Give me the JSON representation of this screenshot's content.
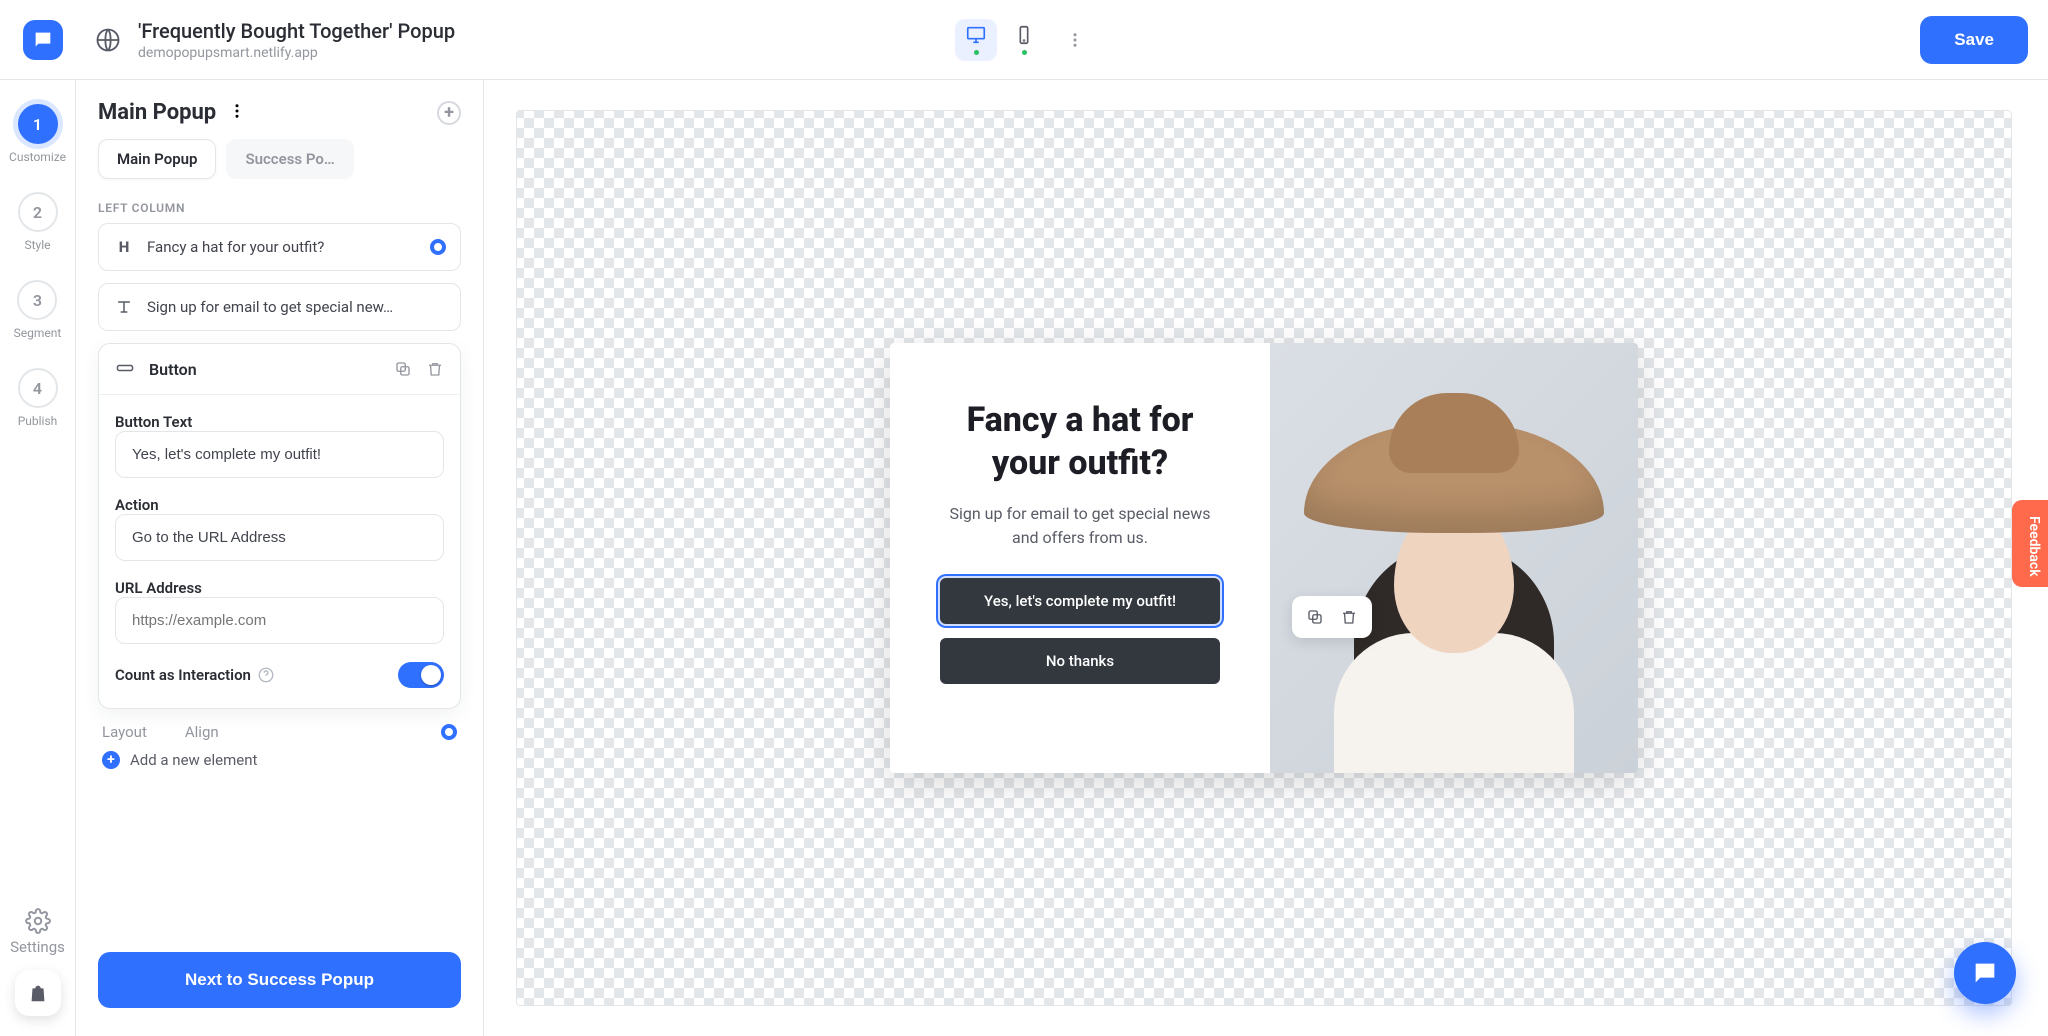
{
  "header": {
    "title": "'Frequently Bought Together' Popup",
    "subtitle": "demopopupsmart.netlify.app",
    "save_label": "Save"
  },
  "rail": {
    "steps": [
      {
        "num": "1",
        "label": "Customize"
      },
      {
        "num": "2",
        "label": "Style"
      },
      {
        "num": "3",
        "label": "Segment"
      },
      {
        "num": "4",
        "label": "Publish"
      }
    ],
    "settings_label": "Settings"
  },
  "panel": {
    "title": "Main Popup",
    "tabs": [
      {
        "label": "Main Popup",
        "active": true
      },
      {
        "label": "Success Po…",
        "active": false
      }
    ],
    "column_label": "LEFT COLUMN",
    "elements": {
      "heading": "Fancy a hat for your outfit?",
      "text": "Sign up for email to get special new…"
    },
    "button_card": {
      "title": "Button",
      "button_text_label": "Button Text",
      "button_text_value": "Yes, let's complete my outfit!",
      "action_label": "Action",
      "action_value": "Go to the URL Address",
      "url_label": "URL Address",
      "url_placeholder": "https://example.com",
      "url_value": "",
      "count_label": "Count as Interaction"
    },
    "section_tabs": {
      "layout": "Layout",
      "align": "Align"
    },
    "add_element_label": "Add a new element",
    "next_label": "Next to Success Popup"
  },
  "popup": {
    "headline": "Fancy a hat for your outfit?",
    "body": "Sign up for email to get special news and offers from us.",
    "cta_primary": "Yes, let's complete my outfit!",
    "cta_secondary": "No thanks"
  },
  "feedback_label": "Feedback"
}
